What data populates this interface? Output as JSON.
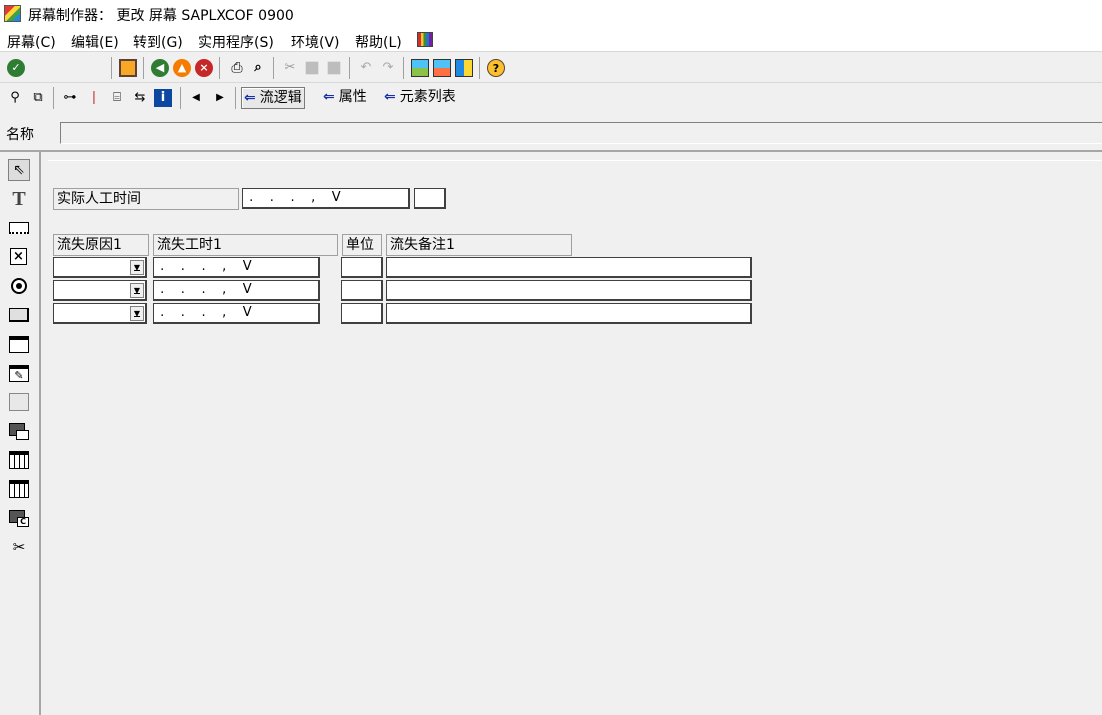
{
  "window": {
    "title": "屏幕制作器： 更改 屏幕 SAPLXCOF 0900"
  },
  "menu": [
    {
      "label": "屏幕(C)"
    },
    {
      "label": "编辑(E)"
    },
    {
      "label": "转到(G)"
    },
    {
      "label": "实用程序(S)"
    },
    {
      "label": "环境(V)"
    },
    {
      "label": "帮助(L)"
    }
  ],
  "app_toolbar": {
    "flow_logic": "流逻辑",
    "attributes": "属性",
    "element_list": "元素列表"
  },
  "name_row": {
    "label": "名称",
    "value": ""
  },
  "screen": {
    "actual_hours_label": "实际人工时间",
    "actual_hours_field": " .    .    .    ,    V",
    "columns": [
      "流失原因1",
      "流失工时1",
      "单位",
      "流失备注1"
    ],
    "row_quantity_text": " .    .    .    ,    V"
  },
  "icons": {
    "toolbar": [
      "check-icon",
      "save-icon",
      "back-icon",
      "exit-icon",
      "cancel-icon",
      "print-icon",
      "find-icon",
      "cut-icon",
      "copy-icon",
      "paste-icon",
      "undo-icon",
      "redo-icon",
      "layout-icon",
      "layout2-icon",
      "layout3-icon",
      "help-icon"
    ],
    "palette": [
      "pointer-icon",
      "text-icon",
      "input-field-icon",
      "checkbox-icon",
      "radio-button-icon",
      "pushbutton-icon",
      "tabstrip-icon",
      "tabstrip-wizard-icon",
      "box-icon",
      "subscreen-icon",
      "table-control-icon",
      "table-wizard-icon",
      "custom-control-icon",
      "status-icon-tool-icon"
    ]
  }
}
